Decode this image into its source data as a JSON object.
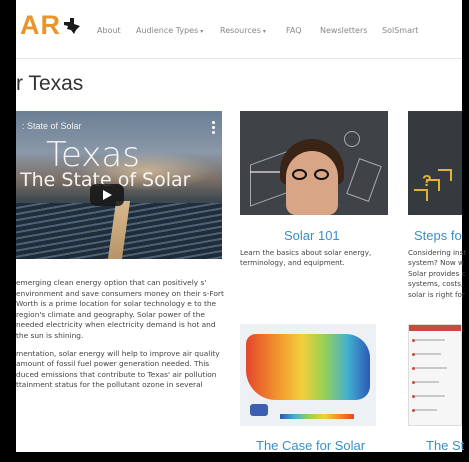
{
  "brand": {
    "logo_text": "AR",
    "logo_color": "#e8952b"
  },
  "nav": {
    "items": [
      {
        "label": "About",
        "has_caret": false
      },
      {
        "label": "Audience Types",
        "has_caret": true
      },
      {
        "label": "Resources",
        "has_caret": true
      },
      {
        "label": "FAQ",
        "has_caret": false
      },
      {
        "label": "Newsletters",
        "has_caret": false
      },
      {
        "label": "SolSmart",
        "has_caret": false
      }
    ]
  },
  "page": {
    "title": "r Texas"
  },
  "video": {
    "top_title": ": State of Solar",
    "big_text": "Texas",
    "sub_text": "The State of Solar",
    "play_icon": "play-icon",
    "menu_icon": "more-vertical-icon"
  },
  "intro": {
    "paragraphs": [
      "emerging clean energy option that can positively s' environment and save consumers money on their s-Fort Worth is a prime location for solar technology e to the region's climate and geography. Solar power of the needed electricity when electricity demand is hot and the sun is shining.",
      "mentation, solar energy will help to improve air quality amount of fossil fuel power generation needed. This duced emissions that contribute to Texas' air pollution ttainment status for the pollutant ozone in several"
    ]
  },
  "cards": [
    {
      "title": "Solar 101",
      "desc": "Learn the basics about solar energy, terminology, and equipment."
    },
    {
      "title": "Steps fo",
      "desc": "Considering inst system? Now w Solar provides c systems, costs, solar is right for"
    },
    {
      "title": "The Case for Solar",
      "desc": ""
    },
    {
      "title": "The St",
      "desc": ""
    }
  ],
  "colors": {
    "link": "#3a8ec9",
    "nav_text": "#888888",
    "accent": "#e8952b"
  }
}
